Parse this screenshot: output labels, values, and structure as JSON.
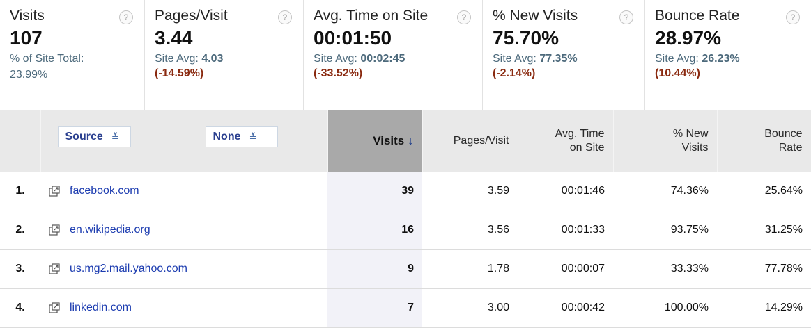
{
  "metrics": [
    {
      "title": "Visits",
      "value": "107",
      "sub_label": "% of Site Total:",
      "sub_value": "23.99%",
      "change": ""
    },
    {
      "title": "Pages/Visit",
      "value": "3.44",
      "sub_label": "Site Avg:",
      "sub_value": "4.03",
      "change": "(-14.59%)"
    },
    {
      "title": "Avg. Time on Site",
      "value": "00:01:50",
      "sub_label": "Site Avg:",
      "sub_value": "00:02:45",
      "change": "(-33.52%)"
    },
    {
      "title": "% New Visits",
      "value": "75.70%",
      "sub_label": "Site Avg:",
      "sub_value": "77.35%",
      "change": "(-2.14%)"
    },
    {
      "title": "Bounce Rate",
      "value": "28.97%",
      "sub_label": "Site Avg:",
      "sub_value": "26.23%",
      "change": "(10.44%)"
    }
  ],
  "help_glyph": "?",
  "table": {
    "primary_dimension": "Source",
    "secondary_dimension": "None",
    "dropdown_glyph": "≚",
    "sort_arrow": "↓",
    "headers": {
      "visits": "Visits",
      "pages_visit": "Pages/Visit",
      "avg_time_1": "Avg. Time",
      "avg_time_2": "on Site",
      "new_visits_1": "% New",
      "new_visits_2": "Visits",
      "bounce_1": "Bounce",
      "bounce_2": "Rate"
    },
    "rows": [
      {
        "index": "1.",
        "source": "facebook.com",
        "visits": "39",
        "pages_visit": "3.59",
        "avg_time": "00:01:46",
        "new_visits": "74.36%",
        "bounce_rate": "25.64%"
      },
      {
        "index": "2.",
        "source": "en.wikipedia.org",
        "visits": "16",
        "pages_visit": "3.56",
        "avg_time": "00:01:33",
        "new_visits": "93.75%",
        "bounce_rate": "31.25%"
      },
      {
        "index": "3.",
        "source": "us.mg2.mail.yahoo.com",
        "visits": "9",
        "pages_visit": "1.78",
        "avg_time": "00:00:07",
        "new_visits": "33.33%",
        "bounce_rate": "77.78%"
      },
      {
        "index": "4.",
        "source": "linkedin.com",
        "visits": "7",
        "pages_visit": "3.00",
        "avg_time": "00:00:42",
        "new_visits": "100.00%",
        "bounce_rate": "14.29%"
      }
    ]
  },
  "colors": {
    "link": "#1c3cb0",
    "negative_change": "#8a2a10",
    "sorted_header": "#a9a9a9",
    "header_bg": "#e9e9e9"
  }
}
